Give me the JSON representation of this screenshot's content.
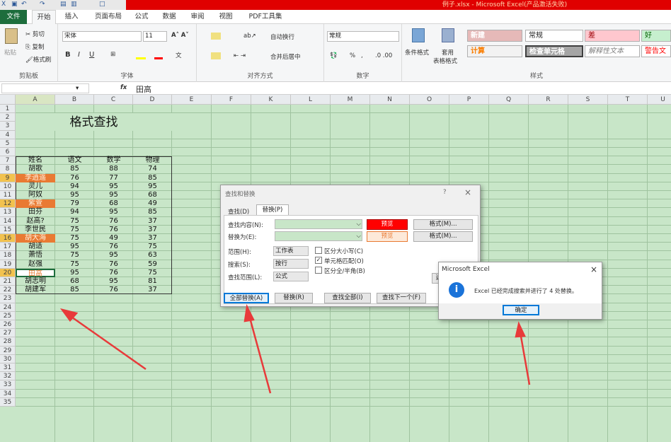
{
  "window": {
    "title": "例子.xlsx - Microsoft Excel(产品激活失败)"
  },
  "ribbon_tabs": [
    "文件",
    "开始",
    "插入",
    "页面布局",
    "公式",
    "数据",
    "审阅",
    "视图",
    "PDF工具集"
  ],
  "clipboard": {
    "paste": "粘贴",
    "cut": "剪切",
    "copy": "复制",
    "painter": "格式刷",
    "label": "剪贴板"
  },
  "font": {
    "name": "宋体",
    "size": "11",
    "label": "字体",
    "bold": "B",
    "italic": "I",
    "underline": "U"
  },
  "alignment": {
    "wrap": "自动换行",
    "merge": "合并后居中",
    "label": "对齐方式"
  },
  "number": {
    "format": "常规",
    "label": "数字",
    "percent": "%",
    "comma": ","
  },
  "styles": {
    "cond": "条件格式",
    "table1": "套用",
    "table2": "表格格式",
    "label": "样式",
    "items": [
      {
        "text": "新建",
        "bg": "#e6b9b8"
      },
      {
        "text": "常规",
        "bg": "#ffffff"
      },
      {
        "text": "差",
        "bg": "#ffc7ce"
      },
      {
        "text": "好",
        "bg": "#c6efce"
      },
      {
        "text": "计算",
        "bg": "#f2f2f2"
      },
      {
        "text": "检查单元格",
        "bg": "#a5a5a5"
      },
      {
        "text": "解释性文本",
        "bg": "#ffffff"
      },
      {
        "text": "警告文",
        "bg": "#ffffff"
      }
    ]
  },
  "formula_bar": {
    "fx": "fx",
    "value": "田高"
  },
  "columns": [
    "A",
    "B",
    "C",
    "D",
    "E",
    "F",
    "K",
    "L",
    "M",
    "N",
    "O",
    "P",
    "Q",
    "R",
    "S",
    "T",
    "U"
  ],
  "rows": [
    "1",
    "2",
    "3",
    "4",
    "5",
    "6",
    "7",
    "8",
    "9",
    "10",
    "11",
    "12",
    "13",
    "14",
    "15",
    "16",
    "17",
    "18",
    "19",
    "20",
    "21",
    "22",
    "23",
    "24",
    "25",
    "26",
    "27",
    "28",
    "29",
    "30",
    "31",
    "32",
    "33",
    "34",
    "35"
  ],
  "sheet_title": "格式查找",
  "table": {
    "headers": [
      "姓名",
      "语文",
      "数学",
      "物理"
    ],
    "rows": [
      [
        "胡歌",
        "85",
        "88",
        "74"
      ],
      [
        "李逍遥",
        "76",
        "77",
        "85"
      ],
      [
        "灵儿",
        "94",
        "95",
        "95"
      ],
      [
        "阿奴",
        "95",
        "95",
        "68"
      ],
      [
        "紫萱",
        "79",
        "68",
        "49"
      ],
      [
        "田芬",
        "94",
        "95",
        "85"
      ],
      [
        "赵高?",
        "75",
        "76",
        "37"
      ],
      [
        "李世民",
        "75",
        "76",
        "37"
      ],
      [
        "胡大海",
        "75",
        "49",
        "37"
      ],
      [
        "胡适",
        "95",
        "76",
        "75"
      ],
      [
        "萧悟",
        "75",
        "95",
        "63"
      ],
      [
        "赵强",
        "75",
        "76",
        "59"
      ],
      [
        "田高",
        "95",
        "76",
        "75"
      ],
      [
        "胡志明",
        "68",
        "95",
        "81"
      ],
      [
        "胡建军",
        "85",
        "76",
        "37"
      ]
    ],
    "highlight_color": "#e97a33"
  },
  "find_dialog": {
    "title": "查找和替换",
    "help": "?",
    "close": "×",
    "tab_find": "查找(D)",
    "tab_replace": "替换(P)",
    "find_label": "查找内容(N):",
    "replace_label": "替换为(E):",
    "preview": "预览",
    "preview2": "预览",
    "format_btn": "格式(M)...",
    "scope_label": "范围(H):",
    "scope_value": "工作表",
    "search_label": "搜索(S):",
    "search_value": "按行",
    "lookin_label": "查找范围(L):",
    "lookin_value": "公式",
    "case": "区分大小写(C)",
    "whole": "单元格匹配(O)",
    "width": "区分全/半角(B)",
    "replace_all": "全部替换(A)",
    "replace": "替换(R)",
    "find_all": "查找全部(I)",
    "find_next": "查找下一个(F)",
    "options_cut": "选"
  },
  "message": {
    "title": "Microsoft Excel",
    "text": "Excel 已经完成搜索并进行了 4 处替换。",
    "ok": "确定",
    "close": "×"
  }
}
